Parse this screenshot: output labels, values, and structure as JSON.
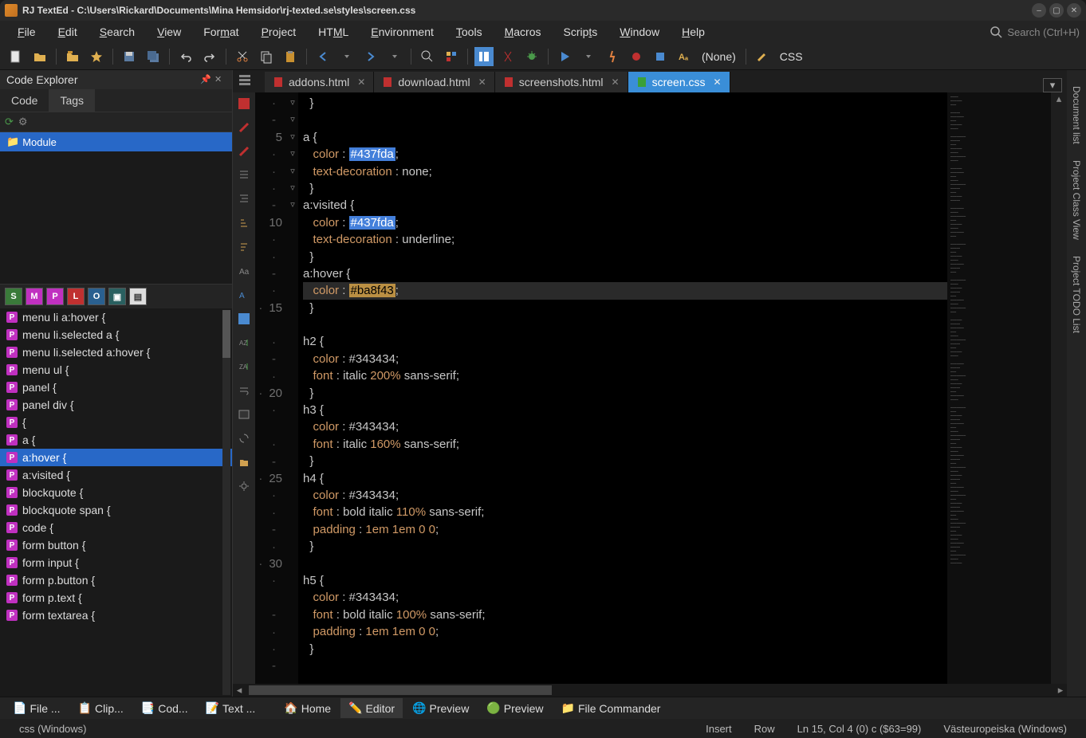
{
  "title": "RJ TextEd - C:\\Users\\Rickard\\Documents\\Mina Hemsidor\\rj-texted.se\\styles\\screen.css",
  "menus": [
    "File",
    "Edit",
    "Search",
    "View",
    "Format",
    "Project",
    "HTML",
    "Environment",
    "Tools",
    "Macros",
    "Scripts",
    "Window",
    "Help"
  ],
  "menuUnderlines": [
    0,
    0,
    0,
    0,
    3,
    0,
    2,
    0,
    0,
    0,
    5,
    0,
    0
  ],
  "searchPlaceholder": "Search (Ctrl+H)",
  "toolbar": {
    "none": "(None)",
    "css": "CSS"
  },
  "leftpanel": {
    "title": "Code Explorer",
    "tabs": [
      "Code",
      "Tags"
    ],
    "activeTab": 1,
    "tree": [
      "Module"
    ],
    "filters": [
      "S",
      "M",
      "P",
      "L",
      "O"
    ],
    "filterColors": [
      "#3a7a3a",
      "#c030c0",
      "#c030c0",
      "#c03030",
      "#2a6090"
    ],
    "symbols": [
      "menu li a:hover {",
      "menu li.selected a {",
      "menu li.selected a:hover {",
      "menu ul {",
      "panel {",
      "panel div {",
      "{",
      "a {",
      "a:hover {",
      "a:visited {",
      "blockquote {",
      "blockquote span {",
      "code {",
      "form button {",
      "form input {",
      "form p.button {",
      "form p.text {",
      "form textarea {"
    ],
    "selectedSymbol": 8
  },
  "tabs": [
    {
      "name": "addons.html",
      "active": false
    },
    {
      "name": "download.html",
      "active": false
    },
    {
      "name": "screenshots.html",
      "active": false
    },
    {
      "name": "screen.css",
      "active": true
    }
  ],
  "code": {
    "startLine": 3,
    "lineNumbers": [
      "",
      "",
      "5",
      "",
      "",
      "",
      "",
      "10",
      "",
      "",
      "",
      "",
      "15",
      "",
      "",
      "",
      "",
      "20",
      "",
      "",
      "",
      "",
      "25",
      "",
      "",
      "",
      "",
      "30",
      "",
      "",
      "",
      ""
    ],
    "gutterMarks": [
      "·",
      "-",
      "",
      "·",
      "·",
      "·",
      "-",
      "",
      "·",
      "·",
      "-",
      "·",
      "·",
      "",
      "·",
      "-",
      "·",
      "·",
      "·",
      "",
      "·",
      "-",
      "·",
      "·",
      "·",
      "-",
      "·",
      "·",
      "·",
      "",
      "-",
      "·",
      "·",
      "-"
    ],
    "foldMarks": [
      "",
      "",
      "",
      "▿",
      "",
      "",
      "",
      "",
      "▿",
      "",
      "",
      "",
      "",
      "▿",
      "",
      "",
      "",
      "",
      "▿",
      "",
      "",
      "",
      "",
      "▿",
      "",
      "",
      "",
      "",
      "▿",
      "",
      "",
      "",
      "",
      "▿"
    ],
    "lines": [
      {
        "t": "  }"
      },
      {
        "t": ""
      },
      {
        "t": "a {",
        "fold": true,
        "selector": "a"
      },
      {
        "t": "   color : ",
        "prop": "color",
        "hex": "#437fda",
        "hexclass": "hex1",
        "after": ";"
      },
      {
        "t": "   text-decoration : none;",
        "prop": "text-decoration",
        "val": "none"
      },
      {
        "t": "  }"
      },
      {
        "t": "a:visited {",
        "fold": true,
        "selector": "a:visited"
      },
      {
        "t": "   color : ",
        "prop": "color",
        "hex": "#437fda",
        "hexclass": "hex1",
        "after": ";"
      },
      {
        "t": "   text-decoration : underline;",
        "prop": "text-decoration",
        "val": "underline"
      },
      {
        "t": "  }"
      },
      {
        "t": "a:hover {",
        "fold": true,
        "selector": "a:hover"
      },
      {
        "t": "   color : ",
        "prop": "color",
        "hex": "#ba8f43",
        "hexclass": "hex2",
        "after": ";",
        "current": true
      },
      {
        "t": "  }"
      },
      {
        "t": ""
      },
      {
        "t": "h2 {",
        "fold": true,
        "selector": "h2"
      },
      {
        "t": "   color : #343434;",
        "prop": "color",
        "hexPlain": "#343434"
      },
      {
        "t": "   font : italic 200% sans-serif;",
        "fontLine": true,
        "fontStyle": "italic",
        "pct": "200%"
      },
      {
        "t": "  }"
      },
      {
        "t": "h3 {",
        "fold": true,
        "selector": "h3"
      },
      {
        "t": "   color : #343434;",
        "prop": "color",
        "hexPlain": "#343434"
      },
      {
        "t": "   font : italic 160% sans-serif;",
        "fontLine": true,
        "fontStyle": "italic",
        "pct": "160%"
      },
      {
        "t": "  }"
      },
      {
        "t": "h4 {",
        "fold": true,
        "selector": "h4"
      },
      {
        "t": "   color : #343434;",
        "prop": "color",
        "hexPlain": "#343434"
      },
      {
        "t": "   font : bold italic 110% sans-serif;",
        "fontLine": true,
        "fontStyle": "bold italic",
        "pct": "110%"
      },
      {
        "t": "   padding : 1em 1em 0 0;",
        "padLine": true
      },
      {
        "t": "  }"
      },
      {
        "t": ""
      },
      {
        "t": "h5 {",
        "fold": true,
        "selector": "h5"
      },
      {
        "t": "   color : #343434;",
        "prop": "color",
        "hexPlain": "#343434"
      },
      {
        "t": "   font : bold italic 100% sans-serif;",
        "fontLine": true,
        "fontStyle": "bold italic",
        "pct": "100%"
      },
      {
        "t": "   padding : 1em 1em 0 0;",
        "padLine": true
      },
      {
        "t": "  }"
      }
    ]
  },
  "rightTabs": [
    "Document list",
    "Project Class View",
    "Project TODO List"
  ],
  "bottomLeftTabs": [
    "File ...",
    "Clip...",
    "Cod...",
    "Text ..."
  ],
  "bottomMainTabs": [
    "Home",
    "Editor",
    "Preview",
    "Preview",
    "File Commander"
  ],
  "bottomActiveTab": 1,
  "status": {
    "left": "css (Windows)",
    "insert": "Insert",
    "row": "Row",
    "pos": "Ln 15, Col 4 (0) c ($63=99)",
    "enc": "Västeuropeiska (Windows)"
  }
}
